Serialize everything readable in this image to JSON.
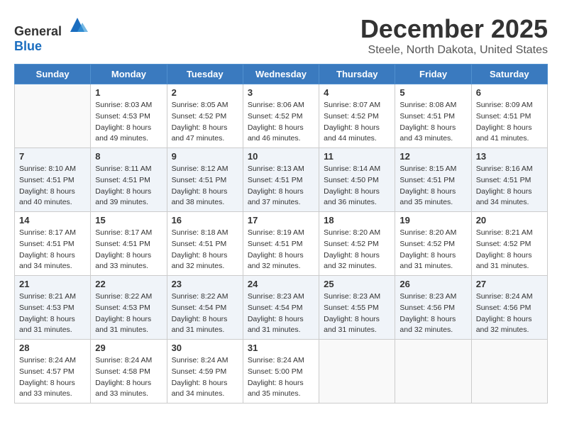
{
  "header": {
    "logo_general": "General",
    "logo_blue": "Blue",
    "month": "December 2025",
    "location": "Steele, North Dakota, United States"
  },
  "weekdays": [
    "Sunday",
    "Monday",
    "Tuesday",
    "Wednesday",
    "Thursday",
    "Friday",
    "Saturday"
  ],
  "weeks": [
    [
      {
        "day": "",
        "sunrise": "",
        "sunset": "",
        "daylight": ""
      },
      {
        "day": "1",
        "sunrise": "Sunrise: 8:03 AM",
        "sunset": "Sunset: 4:53 PM",
        "daylight": "Daylight: 8 hours and 49 minutes."
      },
      {
        "day": "2",
        "sunrise": "Sunrise: 8:05 AM",
        "sunset": "Sunset: 4:52 PM",
        "daylight": "Daylight: 8 hours and 47 minutes."
      },
      {
        "day": "3",
        "sunrise": "Sunrise: 8:06 AM",
        "sunset": "Sunset: 4:52 PM",
        "daylight": "Daylight: 8 hours and 46 minutes."
      },
      {
        "day": "4",
        "sunrise": "Sunrise: 8:07 AM",
        "sunset": "Sunset: 4:52 PM",
        "daylight": "Daylight: 8 hours and 44 minutes."
      },
      {
        "day": "5",
        "sunrise": "Sunrise: 8:08 AM",
        "sunset": "Sunset: 4:51 PM",
        "daylight": "Daylight: 8 hours and 43 minutes."
      },
      {
        "day": "6",
        "sunrise": "Sunrise: 8:09 AM",
        "sunset": "Sunset: 4:51 PM",
        "daylight": "Daylight: 8 hours and 41 minutes."
      }
    ],
    [
      {
        "day": "7",
        "sunrise": "Sunrise: 8:10 AM",
        "sunset": "Sunset: 4:51 PM",
        "daylight": "Daylight: 8 hours and 40 minutes."
      },
      {
        "day": "8",
        "sunrise": "Sunrise: 8:11 AM",
        "sunset": "Sunset: 4:51 PM",
        "daylight": "Daylight: 8 hours and 39 minutes."
      },
      {
        "day": "9",
        "sunrise": "Sunrise: 8:12 AM",
        "sunset": "Sunset: 4:51 PM",
        "daylight": "Daylight: 8 hours and 38 minutes."
      },
      {
        "day": "10",
        "sunrise": "Sunrise: 8:13 AM",
        "sunset": "Sunset: 4:51 PM",
        "daylight": "Daylight: 8 hours and 37 minutes."
      },
      {
        "day": "11",
        "sunrise": "Sunrise: 8:14 AM",
        "sunset": "Sunset: 4:50 PM",
        "daylight": "Daylight: 8 hours and 36 minutes."
      },
      {
        "day": "12",
        "sunrise": "Sunrise: 8:15 AM",
        "sunset": "Sunset: 4:51 PM",
        "daylight": "Daylight: 8 hours and 35 minutes."
      },
      {
        "day": "13",
        "sunrise": "Sunrise: 8:16 AM",
        "sunset": "Sunset: 4:51 PM",
        "daylight": "Daylight: 8 hours and 34 minutes."
      }
    ],
    [
      {
        "day": "14",
        "sunrise": "Sunrise: 8:17 AM",
        "sunset": "Sunset: 4:51 PM",
        "daylight": "Daylight: 8 hours and 34 minutes."
      },
      {
        "day": "15",
        "sunrise": "Sunrise: 8:17 AM",
        "sunset": "Sunset: 4:51 PM",
        "daylight": "Daylight: 8 hours and 33 minutes."
      },
      {
        "day": "16",
        "sunrise": "Sunrise: 8:18 AM",
        "sunset": "Sunset: 4:51 PM",
        "daylight": "Daylight: 8 hours and 32 minutes."
      },
      {
        "day": "17",
        "sunrise": "Sunrise: 8:19 AM",
        "sunset": "Sunset: 4:51 PM",
        "daylight": "Daylight: 8 hours and 32 minutes."
      },
      {
        "day": "18",
        "sunrise": "Sunrise: 8:20 AM",
        "sunset": "Sunset: 4:52 PM",
        "daylight": "Daylight: 8 hours and 32 minutes."
      },
      {
        "day": "19",
        "sunrise": "Sunrise: 8:20 AM",
        "sunset": "Sunset: 4:52 PM",
        "daylight": "Daylight: 8 hours and 31 minutes."
      },
      {
        "day": "20",
        "sunrise": "Sunrise: 8:21 AM",
        "sunset": "Sunset: 4:52 PM",
        "daylight": "Daylight: 8 hours and 31 minutes."
      }
    ],
    [
      {
        "day": "21",
        "sunrise": "Sunrise: 8:21 AM",
        "sunset": "Sunset: 4:53 PM",
        "daylight": "Daylight: 8 hours and 31 minutes."
      },
      {
        "day": "22",
        "sunrise": "Sunrise: 8:22 AM",
        "sunset": "Sunset: 4:53 PM",
        "daylight": "Daylight: 8 hours and 31 minutes."
      },
      {
        "day": "23",
        "sunrise": "Sunrise: 8:22 AM",
        "sunset": "Sunset: 4:54 PM",
        "daylight": "Daylight: 8 hours and 31 minutes."
      },
      {
        "day": "24",
        "sunrise": "Sunrise: 8:23 AM",
        "sunset": "Sunset: 4:54 PM",
        "daylight": "Daylight: 8 hours and 31 minutes."
      },
      {
        "day": "25",
        "sunrise": "Sunrise: 8:23 AM",
        "sunset": "Sunset: 4:55 PM",
        "daylight": "Daylight: 8 hours and 31 minutes."
      },
      {
        "day": "26",
        "sunrise": "Sunrise: 8:23 AM",
        "sunset": "Sunset: 4:56 PM",
        "daylight": "Daylight: 8 hours and 32 minutes."
      },
      {
        "day": "27",
        "sunrise": "Sunrise: 8:24 AM",
        "sunset": "Sunset: 4:56 PM",
        "daylight": "Daylight: 8 hours and 32 minutes."
      }
    ],
    [
      {
        "day": "28",
        "sunrise": "Sunrise: 8:24 AM",
        "sunset": "Sunset: 4:57 PM",
        "daylight": "Daylight: 8 hours and 33 minutes."
      },
      {
        "day": "29",
        "sunrise": "Sunrise: 8:24 AM",
        "sunset": "Sunset: 4:58 PM",
        "daylight": "Daylight: 8 hours and 33 minutes."
      },
      {
        "day": "30",
        "sunrise": "Sunrise: 8:24 AM",
        "sunset": "Sunset: 4:59 PM",
        "daylight": "Daylight: 8 hours and 34 minutes."
      },
      {
        "day": "31",
        "sunrise": "Sunrise: 8:24 AM",
        "sunset": "Sunset: 5:00 PM",
        "daylight": "Daylight: 8 hours and 35 minutes."
      },
      {
        "day": "",
        "sunrise": "",
        "sunset": "",
        "daylight": ""
      },
      {
        "day": "",
        "sunrise": "",
        "sunset": "",
        "daylight": ""
      },
      {
        "day": "",
        "sunrise": "",
        "sunset": "",
        "daylight": ""
      }
    ]
  ]
}
